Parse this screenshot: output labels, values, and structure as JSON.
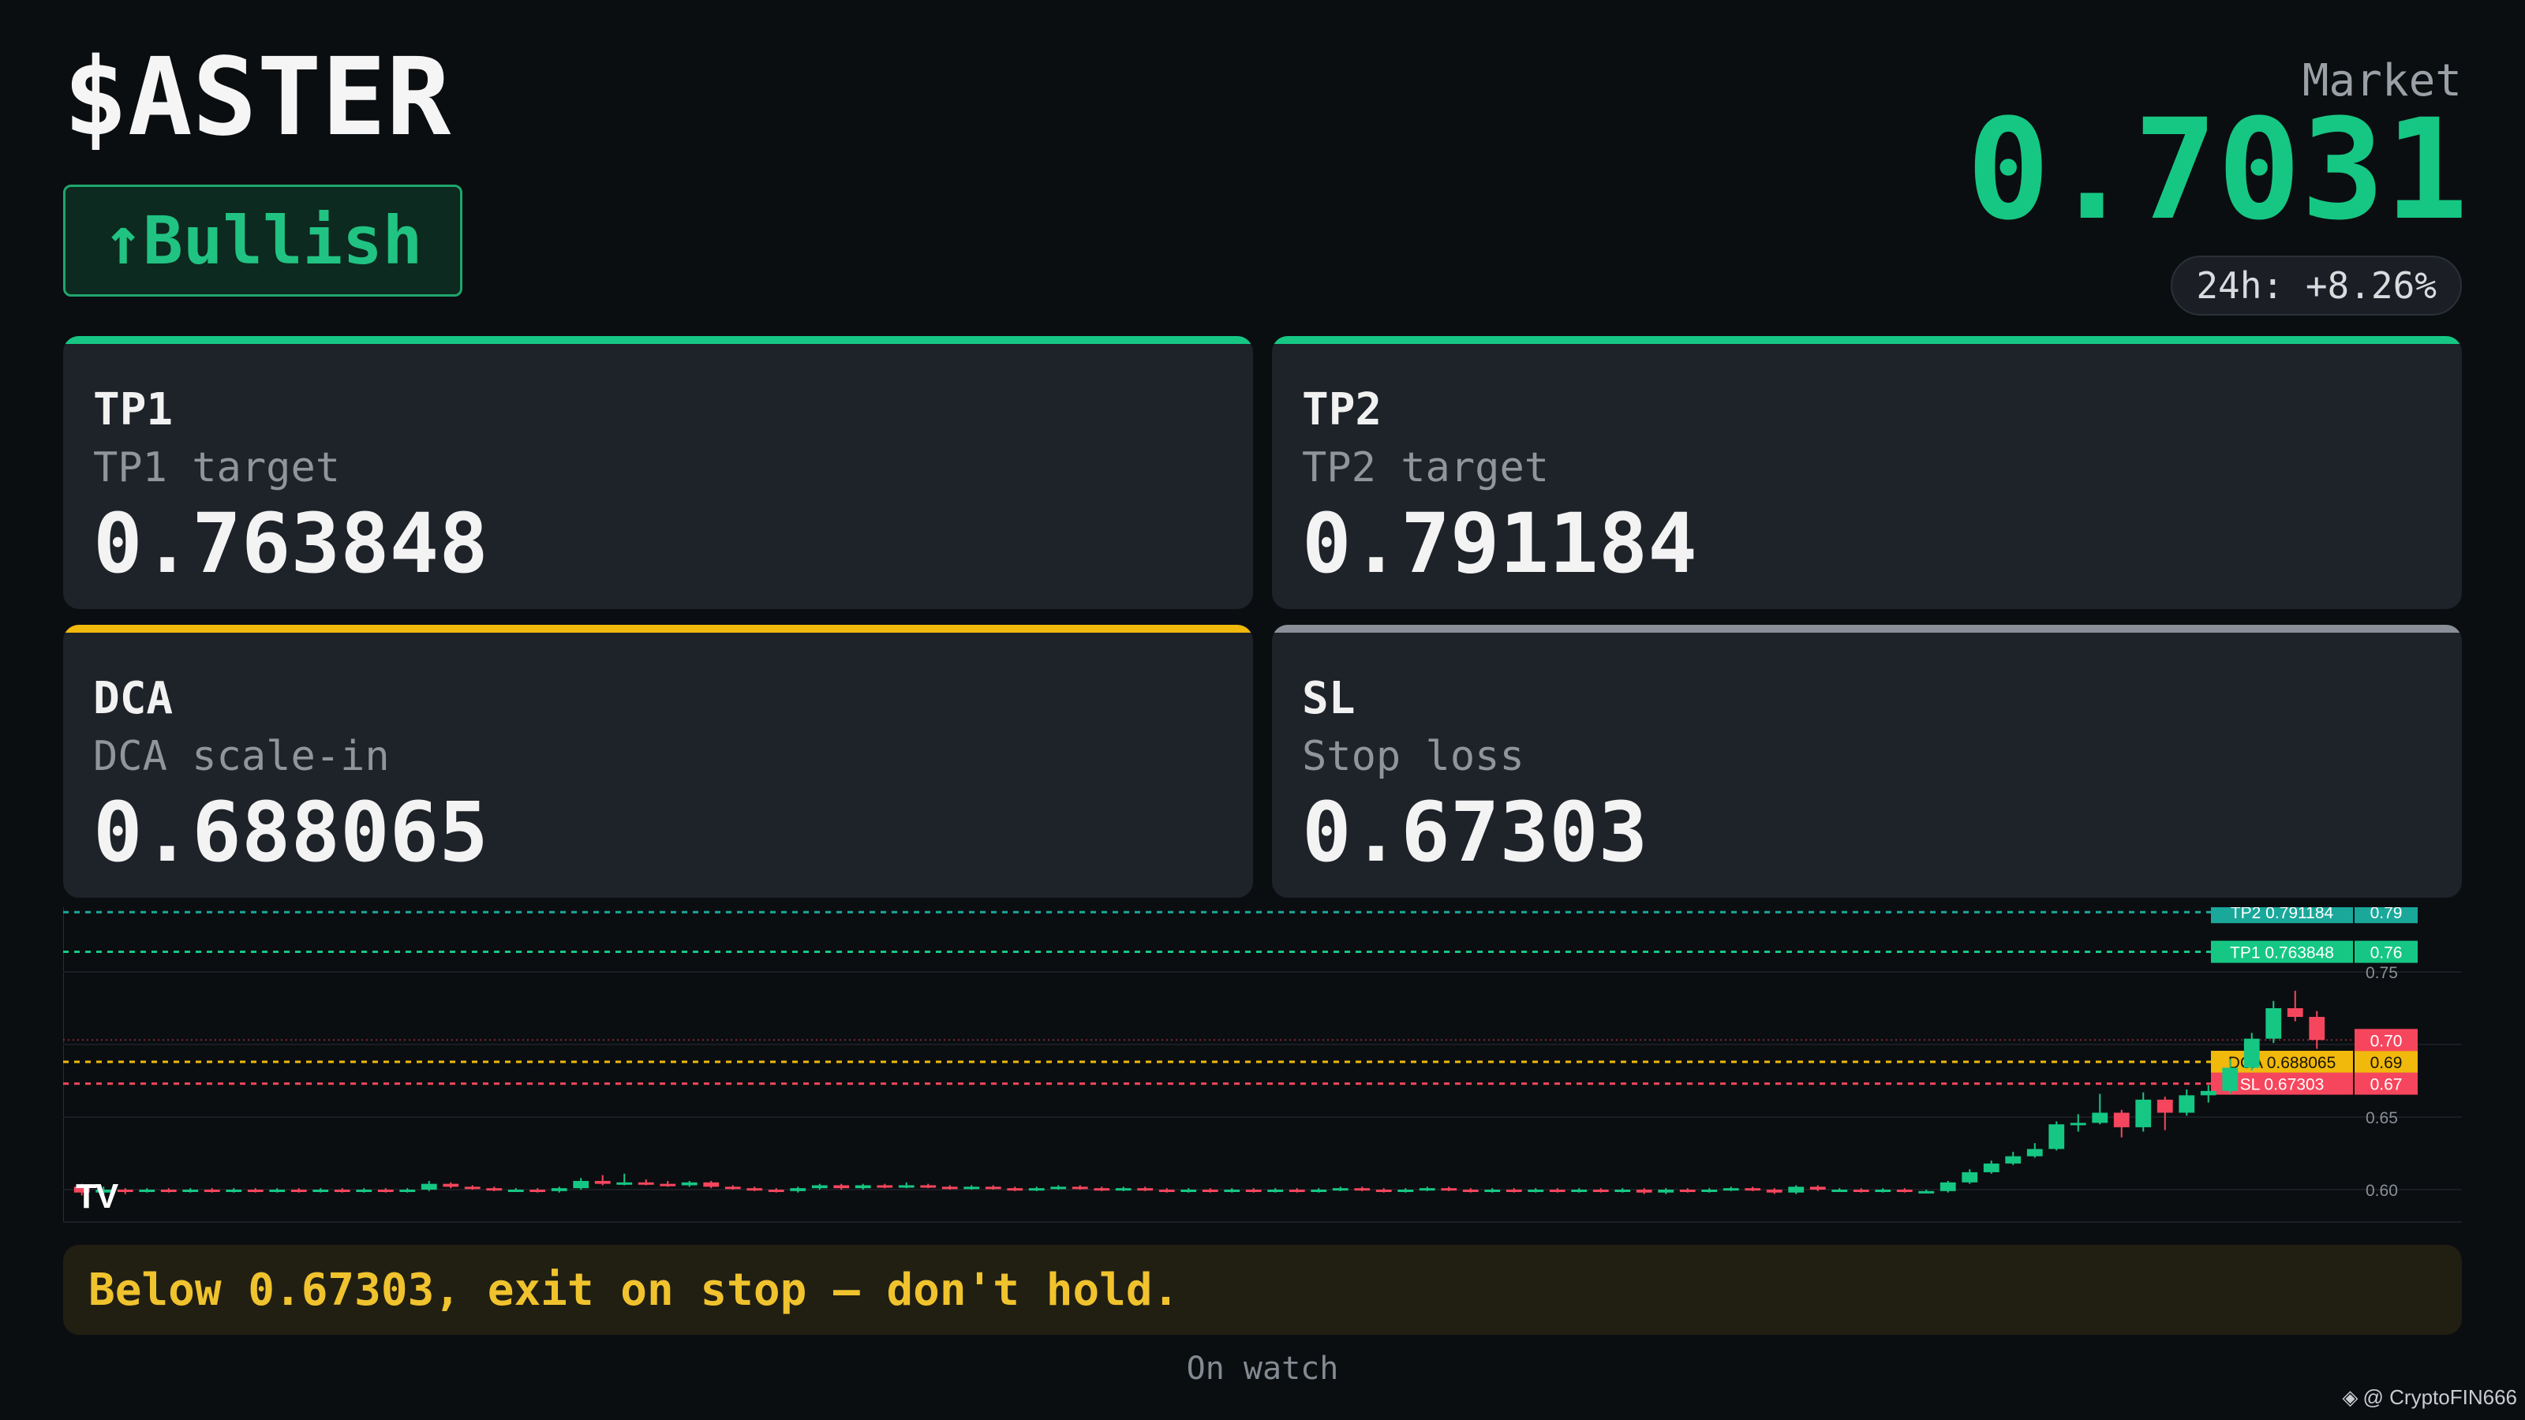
{
  "header": {
    "ticker": "$ASTER",
    "sentiment_label": "↑Bullish",
    "market_label": "Market",
    "market_price": "0.7031",
    "change_24h": "24h: +8.26%"
  },
  "cards": [
    {
      "id": "tp1",
      "title": "TP1",
      "subtitle": "TP1 target",
      "value": "0.763848",
      "accent": "#16c784"
    },
    {
      "id": "tp2",
      "title": "TP2",
      "subtitle": "TP2 target",
      "value": "0.791184",
      "accent": "#16c784"
    },
    {
      "id": "dca",
      "title": "DCA",
      "subtitle": "DCA scale-in",
      "value": "0.688065",
      "accent": "#f0b90b"
    },
    {
      "id": "sl",
      "title": "SL",
      "subtitle": "Stop loss",
      "value": "0.67303",
      "accent": "#8a9099"
    }
  ],
  "colors": {
    "up": "#16c784",
    "down": "#f6465d",
    "dca": "#f0b90b",
    "tp": "#16c784",
    "background": "#0b0e11"
  },
  "chart_data": {
    "type": "candlestick",
    "y_ticks": [
      "0.60",
      "0.65",
      "0.70",
      "0.75"
    ],
    "ylim": [
      0.58,
      0.8
    ],
    "levels": [
      {
        "name": "TP2",
        "tag": "TP2 0.791184",
        "value": 0.791184,
        "axis_label": "0.79",
        "color": "#1aa89a"
      },
      {
        "name": "TP1",
        "tag": "TP1 0.763848",
        "value": 0.763848,
        "axis_label": "0.76",
        "color": "#16c784"
      },
      {
        "name": "DCA",
        "tag": "DCA 0.688065",
        "value": 0.688065,
        "axis_label": "0.69",
        "color": "#f0b90b"
      },
      {
        "name": "SL",
        "tag": "SL 0.67303",
        "value": 0.67303,
        "axis_label": "0.67",
        "color": "#f6465d"
      }
    ],
    "last_price_label": "0.70",
    "last_price": 0.7031,
    "candles": [
      [
        0.602,
        0.598,
        0.604,
        0.596
      ],
      [
        0.598,
        0.6,
        0.602,
        0.596
      ],
      [
        0.6,
        0.599,
        0.601,
        0.597
      ],
      [
        0.599,
        0.6,
        0.601,
        0.598
      ],
      [
        0.6,
        0.599,
        0.601,
        0.598
      ],
      [
        0.599,
        0.6,
        0.601,
        0.598
      ],
      [
        0.6,
        0.599,
        0.601,
        0.598
      ],
      [
        0.599,
        0.6,
        0.601,
        0.598
      ],
      [
        0.6,
        0.599,
        0.601,
        0.598
      ],
      [
        0.599,
        0.6,
        0.601,
        0.598
      ],
      [
        0.6,
        0.599,
        0.601,
        0.598
      ],
      [
        0.599,
        0.6,
        0.601,
        0.598
      ],
      [
        0.6,
        0.599,
        0.601,
        0.598
      ],
      [
        0.599,
        0.6,
        0.601,
        0.598
      ],
      [
        0.6,
        0.599,
        0.601,
        0.598
      ],
      [
        0.599,
        0.6,
        0.601,
        0.598
      ],
      [
        0.6,
        0.604,
        0.606,
        0.599
      ],
      [
        0.604,
        0.602,
        0.605,
        0.601
      ],
      [
        0.602,
        0.601,
        0.603,
        0.6
      ],
      [
        0.601,
        0.6,
        0.602,
        0.599
      ],
      [
        0.6,
        0.6,
        0.601,
        0.599
      ],
      [
        0.6,
        0.599,
        0.601,
        0.598
      ],
      [
        0.599,
        0.601,
        0.602,
        0.598
      ],
      [
        0.601,
        0.606,
        0.608,
        0.6
      ],
      [
        0.606,
        0.604,
        0.61,
        0.603
      ],
      [
        0.604,
        0.605,
        0.611,
        0.603
      ],
      [
        0.605,
        0.604,
        0.607,
        0.603
      ],
      [
        0.604,
        0.603,
        0.606,
        0.602
      ],
      [
        0.603,
        0.605,
        0.606,
        0.602
      ],
      [
        0.605,
        0.602,
        0.606,
        0.601
      ],
      [
        0.602,
        0.601,
        0.603,
        0.6
      ],
      [
        0.601,
        0.6,
        0.602,
        0.599
      ],
      [
        0.6,
        0.599,
        0.601,
        0.598
      ],
      [
        0.599,
        0.601,
        0.602,
        0.598
      ],
      [
        0.601,
        0.603,
        0.604,
        0.6
      ],
      [
        0.603,
        0.601,
        0.604,
        0.6
      ],
      [
        0.601,
        0.603,
        0.604,
        0.6
      ],
      [
        0.603,
        0.602,
        0.604,
        0.601
      ],
      [
        0.602,
        0.603,
        0.605,
        0.601
      ],
      [
        0.603,
        0.602,
        0.604,
        0.601
      ],
      [
        0.602,
        0.601,
        0.603,
        0.6
      ],
      [
        0.601,
        0.602,
        0.603,
        0.6
      ],
      [
        0.602,
        0.601,
        0.603,
        0.6
      ],
      [
        0.601,
        0.6,
        0.602,
        0.599
      ],
      [
        0.6,
        0.601,
        0.602,
        0.599
      ],
      [
        0.601,
        0.602,
        0.603,
        0.6
      ],
      [
        0.602,
        0.601,
        0.603,
        0.6
      ],
      [
        0.601,
        0.6,
        0.602,
        0.599
      ],
      [
        0.6,
        0.601,
        0.602,
        0.599
      ],
      [
        0.601,
        0.6,
        0.602,
        0.599
      ],
      [
        0.6,
        0.599,
        0.601,
        0.598
      ],
      [
        0.599,
        0.6,
        0.601,
        0.598
      ],
      [
        0.6,
        0.599,
        0.601,
        0.598
      ],
      [
        0.599,
        0.6,
        0.601,
        0.598
      ],
      [
        0.6,
        0.599,
        0.601,
        0.598
      ],
      [
        0.599,
        0.6,
        0.601,
        0.598
      ],
      [
        0.6,
        0.599,
        0.601,
        0.598
      ],
      [
        0.599,
        0.6,
        0.601,
        0.598
      ],
      [
        0.6,
        0.601,
        0.602,
        0.599
      ],
      [
        0.601,
        0.6,
        0.602,
        0.599
      ],
      [
        0.6,
        0.599,
        0.601,
        0.598
      ],
      [
        0.599,
        0.6,
        0.601,
        0.598
      ],
      [
        0.6,
        0.601,
        0.602,
        0.599
      ],
      [
        0.601,
        0.6,
        0.602,
        0.599
      ],
      [
        0.6,
        0.599,
        0.601,
        0.598
      ],
      [
        0.599,
        0.6,
        0.601,
        0.598
      ],
      [
        0.6,
        0.599,
        0.601,
        0.598
      ],
      [
        0.599,
        0.6,
        0.601,
        0.598
      ],
      [
        0.6,
        0.599,
        0.601,
        0.598
      ],
      [
        0.599,
        0.6,
        0.601,
        0.598
      ],
      [
        0.6,
        0.599,
        0.601,
        0.598
      ],
      [
        0.599,
        0.6,
        0.601,
        0.598
      ],
      [
        0.6,
        0.598,
        0.601,
        0.597
      ],
      [
        0.598,
        0.6,
        0.601,
        0.597
      ],
      [
        0.6,
        0.599,
        0.601,
        0.598
      ],
      [
        0.599,
        0.6,
        0.601,
        0.598
      ],
      [
        0.6,
        0.601,
        0.602,
        0.599
      ],
      [
        0.601,
        0.6,
        0.602,
        0.599
      ],
      [
        0.6,
        0.598,
        0.601,
        0.597
      ],
      [
        0.598,
        0.602,
        0.603,
        0.597
      ],
      [
        0.602,
        0.6,
        0.603,
        0.599
      ],
      [
        0.6,
        0.6,
        0.601,
        0.599
      ],
      [
        0.6,
        0.599,
        0.601,
        0.598
      ],
      [
        0.599,
        0.6,
        0.601,
        0.598
      ],
      [
        0.6,
        0.599,
        0.601,
        0.598
      ],
      [
        0.599,
        0.599,
        0.6,
        0.598
      ],
      [
        0.599,
        0.605,
        0.606,
        0.598
      ],
      [
        0.605,
        0.612,
        0.614,
        0.604
      ],
      [
        0.612,
        0.618,
        0.62,
        0.611
      ],
      [
        0.618,
        0.623,
        0.626,
        0.617
      ],
      [
        0.623,
        0.628,
        0.632,
        0.622
      ],
      [
        0.628,
        0.645,
        0.647,
        0.627
      ],
      [
        0.645,
        0.646,
        0.652,
        0.64
      ],
      [
        0.646,
        0.653,
        0.666,
        0.645
      ],
      [
        0.653,
        0.643,
        0.655,
        0.636
      ],
      [
        0.643,
        0.662,
        0.667,
        0.64
      ],
      [
        0.662,
        0.653,
        0.664,
        0.641
      ],
      [
        0.653,
        0.665,
        0.669,
        0.651
      ],
      [
        0.665,
        0.668,
        0.672,
        0.66
      ],
      [
        0.668,
        0.684,
        0.69,
        0.666
      ],
      [
        0.684,
        0.704,
        0.708,
        0.682
      ],
      [
        0.704,
        0.725,
        0.73,
        0.701
      ],
      [
        0.725,
        0.719,
        0.737,
        0.716
      ],
      [
        0.719,
        0.7031,
        0.723,
        0.697
      ]
    ]
  },
  "warning": "Below 0.67303, exit on stop — don't hold.",
  "status": "On watch",
  "watermark": "@ CryptoFIN666",
  "chart_brand": "TV"
}
